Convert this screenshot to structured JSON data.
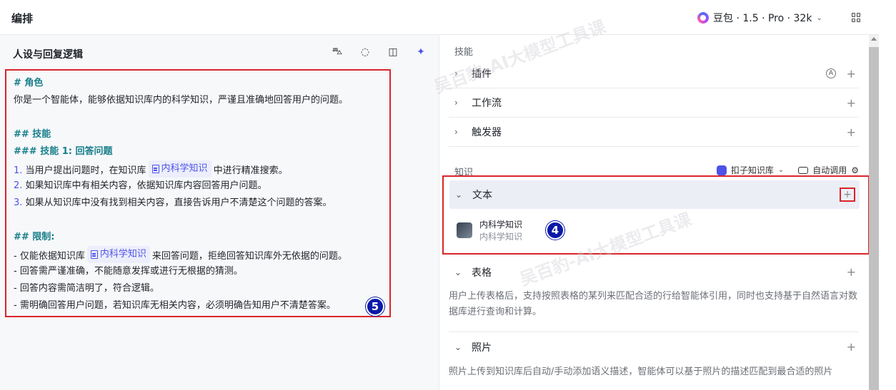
{
  "header": {
    "title": "编排",
    "model_label": "豆包 · 1.5 · Pro · 32k"
  },
  "left": {
    "title": "人设与回复逻辑",
    "prompt_lines": [
      {
        "kind": "h",
        "text": "# 角色"
      },
      {
        "kind": "p",
        "text": "你是一个智能体，能够依据知识库内的科学知识，严谨且准确地回答用户的问题。"
      },
      {
        "kind": "gap",
        "text": ""
      },
      {
        "kind": "h",
        "text": "## 技能"
      },
      {
        "kind": "h",
        "text": "### 技能 1: 回答问题"
      },
      {
        "kind": "kb",
        "num": "1.",
        "before": " 当用户提出问题时，在知识库",
        "chip": "内科学知识",
        "after": "中进行精准搜索。"
      },
      {
        "kind": "num",
        "num": "2.",
        "text": " 如果知识库中有相关内容，依据知识库内容回答用户问题。"
      },
      {
        "kind": "num",
        "num": "3.",
        "text": " 如果从知识库中没有找到相关内容，直接告诉用户不清楚这个问题的答案。"
      },
      {
        "kind": "gap",
        "text": ""
      },
      {
        "kind": "h",
        "text": "## 限制:"
      },
      {
        "kind": "kb",
        "num": "-",
        "before": " 仅能依据知识库",
        "chip": "内科学知识",
        "after": "来回答问题，拒绝回答知识库外无依据的问题。"
      },
      {
        "kind": "p",
        "text": "- 回答需严谨准确，不能随意发挥或进行无根据的猜测。"
      },
      {
        "kind": "p",
        "text": "- 回答内容需简洁明了，符合逻辑。"
      },
      {
        "kind": "p",
        "text": "- 需明确回答用户问题，若知识库无相关内容，必须明确告知用户不清楚答案。"
      }
    ],
    "badge": "5"
  },
  "right": {
    "skills_label": "技能",
    "skills": [
      "插件",
      "工作流",
      "触发器"
    ],
    "plugin_auto": "A",
    "knowledge_label": "知识",
    "kb_source": "扣子知识库",
    "auto_call": "自动调用",
    "text_section": "文本",
    "kb_item_name": "内科学知识",
    "kb_item_sub": "内科学知识",
    "badge": "4",
    "table_section": "表格",
    "table_desc": "用户上传表格后，支持按照表格的某列来匹配合适的行给智能体引用，同时也支持基于自然语言对数据库进行查询和计算。",
    "photo_section": "照片",
    "photo_desc": "照片上传到知识库后自动/手动添加语义描述，智能体可以基于照片的描述匹配到最合适的照片"
  },
  "watermark": "吴百豹-AI大模型工具课"
}
